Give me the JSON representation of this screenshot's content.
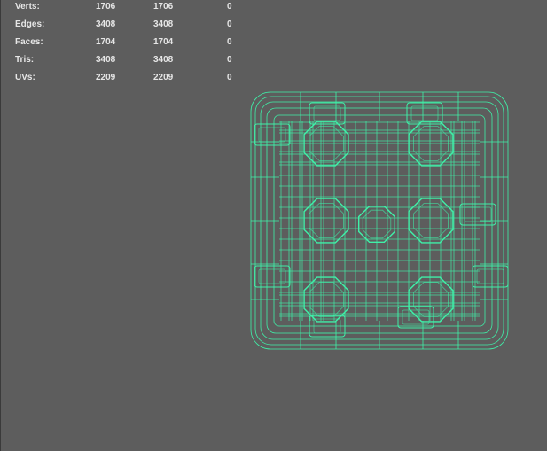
{
  "hud": {
    "rows": [
      {
        "label": "Verts:",
        "object": "1706",
        "selected": "1706",
        "component": "0"
      },
      {
        "label": "Edges:",
        "object": "3408",
        "selected": "3408",
        "component": "0"
      },
      {
        "label": "Faces:",
        "object": "1704",
        "selected": "1704",
        "component": "0"
      },
      {
        "label": "Tris:",
        "object": "3408",
        "selected": "3408",
        "component": "0"
      },
      {
        "label": "UVs:",
        "object": "2209",
        "selected": "2209",
        "component": "0"
      }
    ]
  },
  "colors": {
    "background": "#5d5d5d",
    "wireframe": "#3ff0a8",
    "hud_text": "#e6e6e6"
  },
  "viewport": {
    "object": "dice-wireframe",
    "shading": "wireframe"
  }
}
